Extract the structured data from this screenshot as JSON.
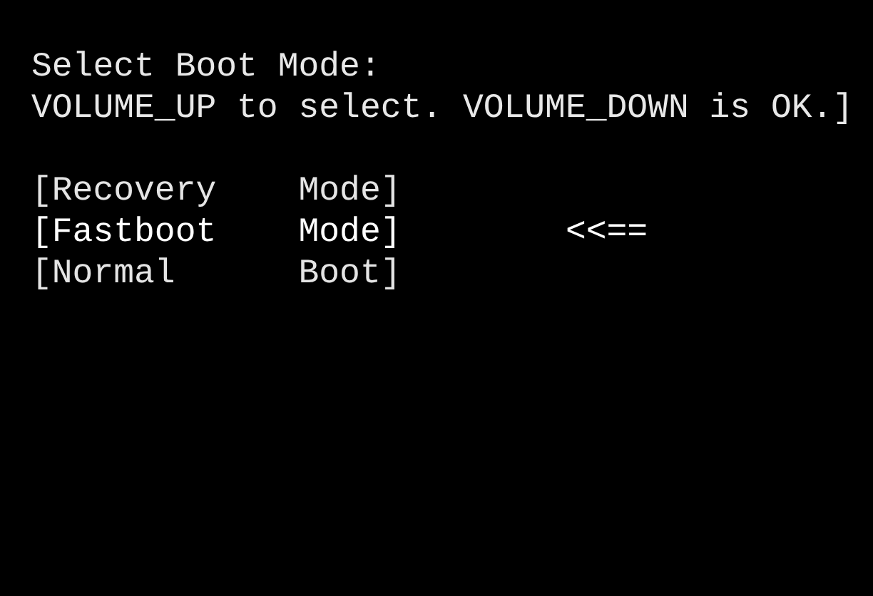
{
  "title": "Select Boot Mode:",
  "instructions": "VOLUME_UP to select. VOLUME_DOWN is OK.]",
  "selection_marker": "<<==",
  "options": [
    {
      "label": "[Recovery    Mode]",
      "selected": false
    },
    {
      "label": "[Fastboot    Mode]",
      "selected": true
    },
    {
      "label": "[Normal      Boot]",
      "selected": false
    }
  ]
}
